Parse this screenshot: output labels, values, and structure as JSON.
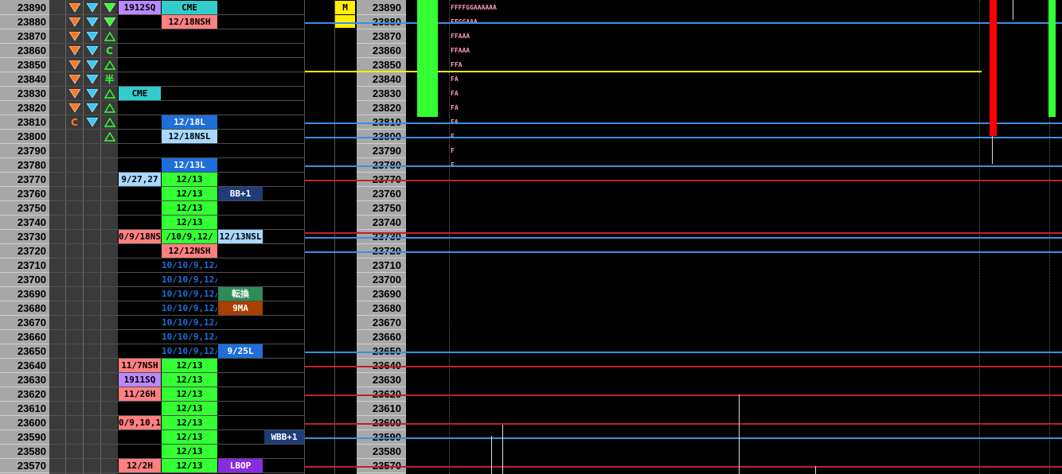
{
  "prices": [
    23890,
    23880,
    23870,
    23860,
    23850,
    23840,
    23830,
    23820,
    23810,
    23800,
    23790,
    23780,
    23770,
    23760,
    23750,
    23740,
    23730,
    23720,
    23710,
    23700,
    23690,
    23680,
    23670,
    23660,
    23650,
    23640,
    23630,
    23620,
    23610,
    23600,
    23590,
    23580,
    23570
  ],
  "signals": {
    "col1": [
      "down",
      "down",
      "down",
      "down",
      "down",
      "down",
      "down",
      "down",
      "C",
      "",
      "",
      "",
      "",
      "",
      "",
      "",
      "",
      "",
      "",
      "",
      "",
      "",
      "",
      "",
      "",
      "",
      "",
      "",
      "",
      "",
      "",
      "",
      ""
    ],
    "col2": [
      "down",
      "down",
      "down",
      "down",
      "down",
      "down",
      "down",
      "down",
      "down",
      "",
      "",
      "",
      "",
      "",
      "",
      "",
      "",
      "",
      "",
      "",
      "",
      "",
      "",
      "",
      "",
      "",
      "",
      "",
      "",
      "",
      "",
      "",
      ""
    ],
    "col3": [
      "down",
      "down",
      "up",
      "C",
      "up",
      "半",
      "up",
      "up",
      "up",
      "up",
      "",
      "",
      "",
      "",
      "",
      "",
      "",
      "",
      "",
      "",
      "",
      "",
      "",
      "",
      "",
      "",
      "",
      "",
      "",
      "",
      "",
      "",
      ""
    ]
  },
  "labels": {
    "a": [
      "1912SQ",
      "",
      "",
      "",
      "",
      "",
      "CME",
      "",
      "",
      "",
      "",
      "",
      "9/27,27",
      "",
      "",
      "",
      "0/9/18NS",
      "",
      "",
      "",
      "",
      "",
      "",
      "",
      "",
      "11/7NSH",
      "1911SQ",
      "11/26H",
      "",
      "0/9,10,1",
      "",
      "",
      "12/2H"
    ],
    "b": [
      "CME",
      "12/18NSH",
      "",
      "",
      "",
      "",
      "",
      "",
      "12/18L",
      "12/18NSL",
      "",
      "12/13L",
      "12/13",
      "12/13",
      "12/13",
      "12/13",
      "/10/9,12/",
      "12/12NSH",
      "10/10/9,12/",
      "10/10/9,12/",
      "10/10/9,12/",
      "10/10/9,12/",
      "10/10/9,12/",
      "10/10/9,12/",
      "10/10/9,12/",
      "12/13",
      "12/13",
      "12/13",
      "12/13",
      "12/13",
      "12/13",
      "12/13",
      "12/13"
    ],
    "c": [
      "",
      "",
      "",
      "",
      "",
      "",
      "",
      "",
      "",
      "",
      "",
      "",
      "",
      "BB+1",
      "",
      "",
      "12/13NSL",
      "",
      "",
      "",
      "転換",
      "9MA",
      "",
      "",
      "9/25L",
      "",
      "",
      "",
      "",
      "",
      "",
      "",
      "LBOP"
    ],
    "d": [
      "",
      "",
      "",
      "",
      "",
      "",
      "",
      "",
      "",
      "",
      "",
      "",
      "",
      "",
      "",
      "",
      "",
      "",
      "",
      "",
      "",
      "",
      "",
      "",
      "",
      "",
      "",
      "",
      "",
      "",
      "WBB+1",
      "",
      ""
    ],
    "e": [
      "M",
      "",
      "",
      "",
      "",
      "",
      "",
      "",
      "",
      "",
      "",
      "",
      "",
      "",
      "",
      "",
      "",
      "",
      "",
      "",
      "",
      "",
      "",
      "",
      "",
      "",
      "",
      "",
      "",
      "",
      "",
      "",
      ""
    ]
  },
  "profile": [
    "FFFFGGAAAAAA",
    "FFGGAAA",
    "FFAAA",
    "FFAAA",
    "FFA",
    "FA",
    "FA",
    "FA",
    "FA",
    "F",
    "F",
    "F",
    "",
    "",
    "",
    "",
    "",
    "",
    "",
    "",
    "",
    "",
    "",
    "",
    "",
    "",
    "",
    "",
    "",
    "",
    "",
    "",
    ""
  ],
  "colors": {
    "green": "#33ff33",
    "lightgreen": "#b0ffb0",
    "cyan": "#33cccc",
    "salmon": "#ff8080",
    "lavender": "#bb88ff",
    "blue": "#1e6fd9",
    "lightblue": "#a8d8ff",
    "darkblue": "#1e3c78",
    "darkgreen": "#2e8b57",
    "brown": "#a84000",
    "purple": "#8a2be2",
    "yellow": "#ffee00",
    "red": "#ff0000",
    "orange": "#ff7722",
    "triblue": "#33ccff",
    "trigreen": "#33ff33"
  }
}
